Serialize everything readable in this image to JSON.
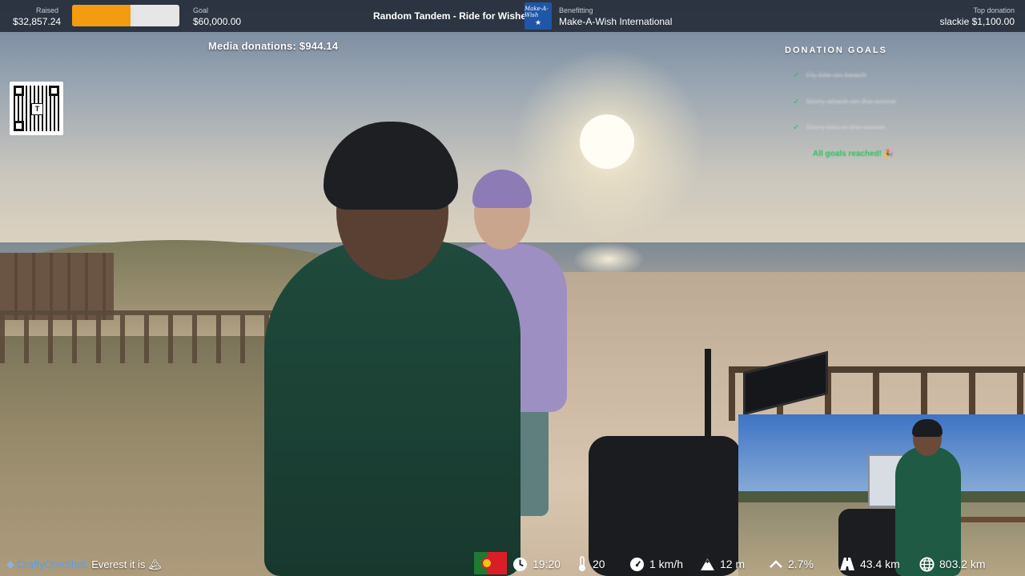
{
  "topbar": {
    "raised_label": "Raised",
    "raised_value": "$32,857.24",
    "progress_fraction": 0.548,
    "goal_label": "Goal",
    "goal_value": "$60,000.00",
    "event_title": "Random Tandem - Ride for Wishes",
    "charity_logo_text": "Make-A-Wish",
    "benefitting_label": "Benefitting",
    "benefitting_value": "Make-A-Wish International",
    "top_donation_label": "Top donation",
    "top_donation_value": "slackie $1,100.00"
  },
  "media_donations": "Media donations: $944.14",
  "donation_goals": {
    "title": "DONATION GOALS",
    "items": [
      {
        "text": "Fly kite on beach",
        "done": true
      },
      {
        "text": "Story attack on the scene",
        "done": true
      },
      {
        "text": "Story bits in the scene",
        "done": true
      }
    ],
    "completed_text": "All goals reached! 🎉"
  },
  "chat": {
    "user": "CraftyOneShot:",
    "message": "Everest it is 🏔"
  },
  "stats": {
    "country_flag": "portugal-flag",
    "time": "19:20",
    "temperature": "20",
    "speed": "1 km/h",
    "altitude": "12 m",
    "grade": "2.7%",
    "distance_today": "43.4 km",
    "distance_total": "803.2 km"
  },
  "colors": {
    "accent_orange": "#f39c12",
    "goal_green": "#22c55e",
    "chat_user_blue": "#4aa3ff",
    "topbar_bg": "#262e3a"
  }
}
